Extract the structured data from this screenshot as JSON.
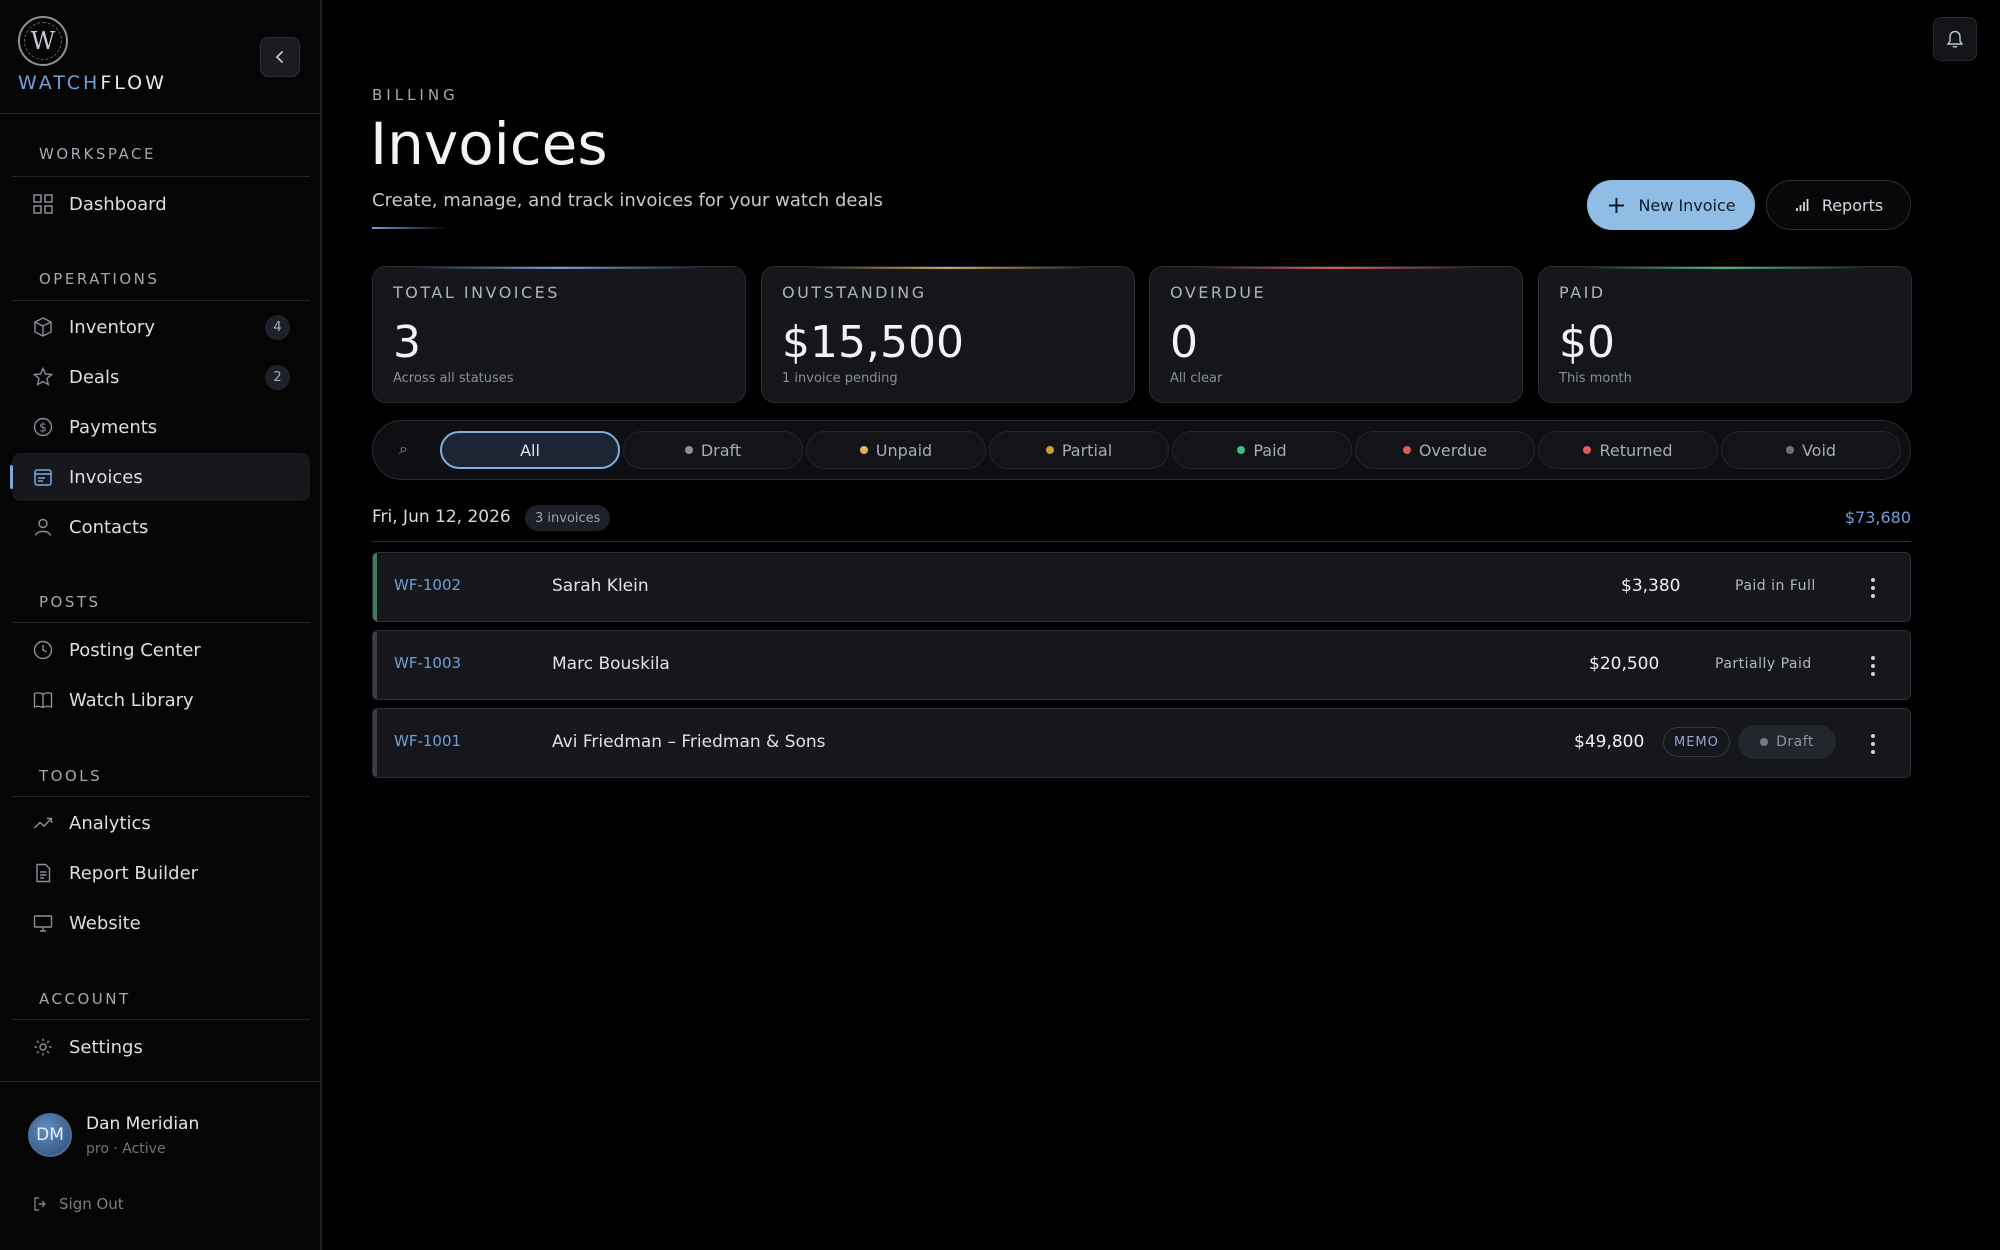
{
  "brand": {
    "logo_letter": "W",
    "name_part1": "WATCH",
    "name_part2": "FLOW"
  },
  "sidebar": {
    "sections": {
      "workspace": "WORKSPACE",
      "operations": "OPERATIONS",
      "posts": "POSTS",
      "tools": "TOOLS",
      "account": "ACCOUNT"
    },
    "items": [
      {
        "label": "Dashboard",
        "icon": "grid-icon"
      },
      {
        "label": "Inventory",
        "icon": "box-icon",
        "badge": "4"
      },
      {
        "label": "Deals",
        "icon": "star-icon",
        "badge": "2"
      },
      {
        "label": "Payments",
        "icon": "dollar-icon"
      },
      {
        "label": "Invoices",
        "icon": "invoice-icon",
        "active": true
      },
      {
        "label": "Contacts",
        "icon": "person-icon"
      },
      {
        "label": "Posting Center",
        "icon": "clock-icon"
      },
      {
        "label": "Watch Library",
        "icon": "book-icon"
      },
      {
        "label": "Analytics",
        "icon": "trend-icon"
      },
      {
        "label": "Report Builder",
        "icon": "document-icon"
      },
      {
        "label": "Website",
        "icon": "monitor-icon"
      },
      {
        "label": "Settings",
        "icon": "gear-icon"
      }
    ]
  },
  "user": {
    "initials": "DM",
    "name": "Dan Meridian",
    "plan": "pro · Active",
    "signout": "Sign Out"
  },
  "header": {
    "eyebrow": "BILLING",
    "title": "Invoices",
    "subtitle": "Create, manage, and track invoices for your watch deals",
    "new_button": "New Invoice",
    "reports_button": "Reports"
  },
  "stats": [
    {
      "label": "TOTAL INVOICES",
      "value": "3",
      "note": "Across all statuses",
      "accent": "#6f9fd4"
    },
    {
      "label": "OUTSTANDING",
      "value": "$15,500",
      "note": "1 invoice pending",
      "accent": "#d3a24a"
    },
    {
      "label": "OVERDUE",
      "value": "0",
      "note": "All clear",
      "accent": "#e05a5a"
    },
    {
      "label": "PAID",
      "value": "$0",
      "note": "This month",
      "accent": "#46b87c"
    }
  ],
  "filters": [
    {
      "label": "All",
      "active": true
    },
    {
      "label": "Draft",
      "dot": "#8c8f96"
    },
    {
      "label": "Unpaid",
      "dot": "#e3b24f"
    },
    {
      "label": "Partial",
      "dot": "#d39a3c"
    },
    {
      "label": "Paid",
      "dot": "#3fbf7f"
    },
    {
      "label": "Overdue",
      "dot": "#e05a5a"
    },
    {
      "label": "Returned",
      "dot": "#e05a5a"
    },
    {
      "label": "Void",
      "dot": "#6e7178"
    }
  ],
  "group": {
    "date": "Fri, Jun 12, 2026",
    "count": "3 invoices",
    "total": "$73,680"
  },
  "invoices": [
    {
      "id": "WF-1002",
      "client": "Sarah Klein",
      "amount": "$3,380",
      "status": "Paid in Full"
    },
    {
      "id": "WF-1003",
      "client": "Marc Bouskila",
      "amount": "$20,500",
      "status": "Partially Paid"
    },
    {
      "id": "WF-1001",
      "client": "Avi Friedman – Friedman & Sons",
      "amount": "$49,800",
      "tag": "MEMO",
      "status": "Draft"
    }
  ]
}
